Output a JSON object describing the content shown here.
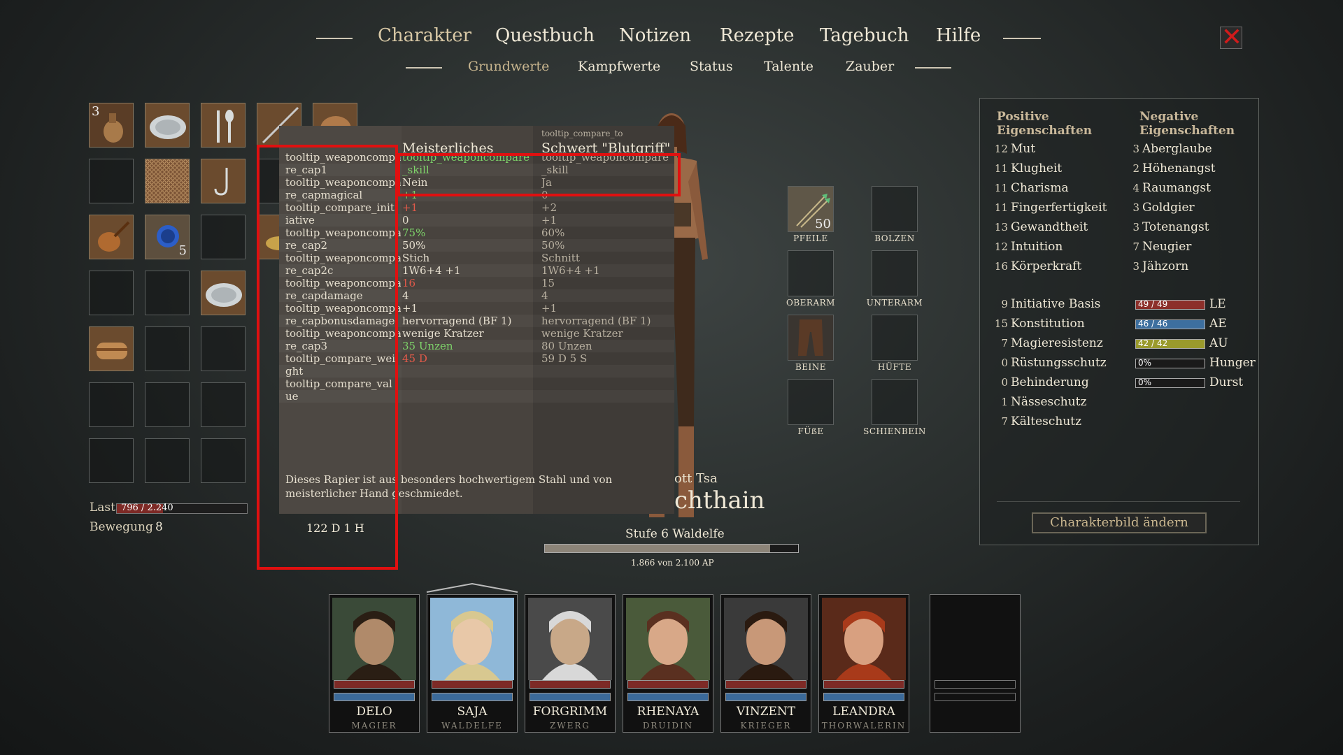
{
  "nav": {
    "main_tabs": [
      "Charakter",
      "Questbuch",
      "Notizen",
      "Rezepte",
      "Tagebuch",
      "Hilfe"
    ],
    "sub_tabs": [
      "Grundwerte",
      "Kampfwerte",
      "Status",
      "Talente",
      "Zauber"
    ],
    "close_glyph": "✕"
  },
  "inventory": {
    "counts": {
      "item1": "3",
      "item9": "5"
    },
    "load_label": "Last",
    "load_value": "796 / 2.240",
    "load_fraction": 0.355,
    "move_label": "Bewegung",
    "move_value": "8",
    "money": "122 D 1 H"
  },
  "tooltip": {
    "current_name": "Meisterliches",
    "compare_to_label": "tooltip_compare_to",
    "compare_name": "Schwert \"Blutgriff\"",
    "rows": [
      {
        "label": "tooltip_weaponcompa",
        "cur": "tooltip_weaponcompare",
        "cmp": "tooltip_weaponcompare"
      },
      {
        "label": "re_cap1",
        "cur": "_skill",
        "cmp": "_skill"
      },
      {
        "label": "tooltip_weaponcompa",
        "cur": "Nein",
        "cmp": "Ja"
      },
      {
        "label": "re_capmagical",
        "cur": "+1",
        "cmp": "0"
      },
      {
        "label": "tooltip_compare_init",
        "cur": "+1",
        "cmp": "+2"
      },
      {
        "label": "iative",
        "cur": "0",
        "cmp": "+1"
      },
      {
        "label": "tooltip_weaponcompa",
        "cur": "75%",
        "cmp": "60%"
      },
      {
        "label": "re_cap2",
        "cur": "50%",
        "cmp": "50%"
      },
      {
        "label": "tooltip_weaponcompa",
        "cur": "Stich",
        "cmp": "Schnitt"
      },
      {
        "label": "re_cap2c",
        "cur": "1W6+4 +1",
        "cmp": "1W6+4 +1"
      },
      {
        "label": "tooltip_weaponcompa",
        "cur": "16",
        "cmp": "15"
      },
      {
        "label": "re_capdamage",
        "cur": "4",
        "cmp": "4"
      },
      {
        "label": "tooltip_weaponcompa",
        "cur": "+1",
        "cmp": "+1"
      },
      {
        "label": "re_capbonusdamage",
        "cur": "hervorragend (BF 1)",
        "cmp": "hervorragend (BF 1)"
      },
      {
        "label": "tooltip_weaponcompa",
        "cur": "wenige Kratzer",
        "cmp": "wenige Kratzer"
      },
      {
        "label": "re_cap3",
        "cur": "35 Unzen",
        "cmp": "80 Unzen"
      },
      {
        "label": "tooltip_compare_wei",
        "cur": "45 D",
        "cmp": "59 D 5 S"
      },
      {
        "label": "ght",
        "cur": "",
        "cmp": ""
      },
      {
        "label": "tooltip_compare_val",
        "cur": "",
        "cmp": ""
      },
      {
        "label": "ue",
        "cur": "",
        "cmp": ""
      }
    ],
    "description": "Dieses Rapier ist aus besonders hochwertigem Stahl und von meisterlicher Hand geschmiedet."
  },
  "character": {
    "name_fragment_1": "ott Tsa",
    "name_fragment_2": "chthain",
    "level_line": "Stufe 6 Waldelfe",
    "ap_text": "1.866 von 2.100 AP",
    "ap_fraction": 0.889
  },
  "equipment": {
    "arrows_count": "50",
    "labels": [
      "PFEILE",
      "BOLZEN",
      "OBERARM",
      "UNTERARM",
      "BEINE",
      "HÜFTE",
      "FÜßE",
      "SCHIENBEIN"
    ]
  },
  "attributes": {
    "positive_title_1": "Positive",
    "positive_title_2": "Eigenschaften",
    "negative_title_1": "Negative",
    "negative_title_2": "Eigenschaften",
    "positive": [
      {
        "v": "12",
        "name": "Mut"
      },
      {
        "v": "11",
        "name": "Klugheit"
      },
      {
        "v": "11",
        "name": "Charisma"
      },
      {
        "v": "11",
        "name": "Fingerfertigkeit"
      },
      {
        "v": "13",
        "name": "Gewandtheit"
      },
      {
        "v": "12",
        "name": "Intuition"
      },
      {
        "v": "16",
        "name": "Körperkraft"
      }
    ],
    "negative": [
      {
        "v": "3",
        "name": "Aberglaube"
      },
      {
        "v": "2",
        "name": "Höhenangst"
      },
      {
        "v": "4",
        "name": "Raumangst"
      },
      {
        "v": "3",
        "name": "Goldgier"
      },
      {
        "v": "3",
        "name": "Totenangst"
      },
      {
        "v": "7",
        "name": "Neugier"
      },
      {
        "v": "3",
        "name": "Jähzorn"
      }
    ],
    "derived": [
      {
        "v": "9",
        "name": "Initiative Basis"
      },
      {
        "v": "15",
        "name": "Konstitution"
      },
      {
        "v": "7",
        "name": "Magieresistenz"
      },
      {
        "v": "0",
        "name": "Rüstungsschutz"
      },
      {
        "v": "0",
        "name": "Behinderung"
      },
      {
        "v": "1",
        "name": "Nässeschutz"
      },
      {
        "v": "7",
        "name": "Kälteschutz"
      }
    ],
    "bars": [
      {
        "text": "49 / 49",
        "label": "LE",
        "fraction": 1.0,
        "color": "#8c2f2a"
      },
      {
        "text": "46 / 46",
        "label": "AE",
        "fraction": 1.0,
        "color": "#3d6f9f"
      },
      {
        "text": "42 / 42",
        "label": "AU",
        "fraction": 1.0,
        "color": "#9a9a2c"
      },
      {
        "text": "0%",
        "label": "Hunger",
        "fraction": 0.0,
        "color": "#888888"
      },
      {
        "text": "0%",
        "label": "Durst",
        "fraction": 0.0,
        "color": "#888888"
      }
    ],
    "change_portrait_button": "Charakterbild ändern"
  },
  "party": [
    {
      "name": "DELO",
      "cls": "MAGIER"
    },
    {
      "name": "SAJA",
      "cls": "WALDELFE"
    },
    {
      "name": "FORGRIMM",
      "cls": "ZWERG"
    },
    {
      "name": "RHENAYA",
      "cls": "DRUIDIN"
    },
    {
      "name": "VINZENT",
      "cls": "KRIEGER"
    },
    {
      "name": "LEANDRA",
      "cls": "THORWALERIN"
    }
  ],
  "colors": {
    "highlight_box": "#e01010",
    "better": "#7ed36a",
    "worse": "#e25a4a",
    "accent": "#c9b68f"
  }
}
